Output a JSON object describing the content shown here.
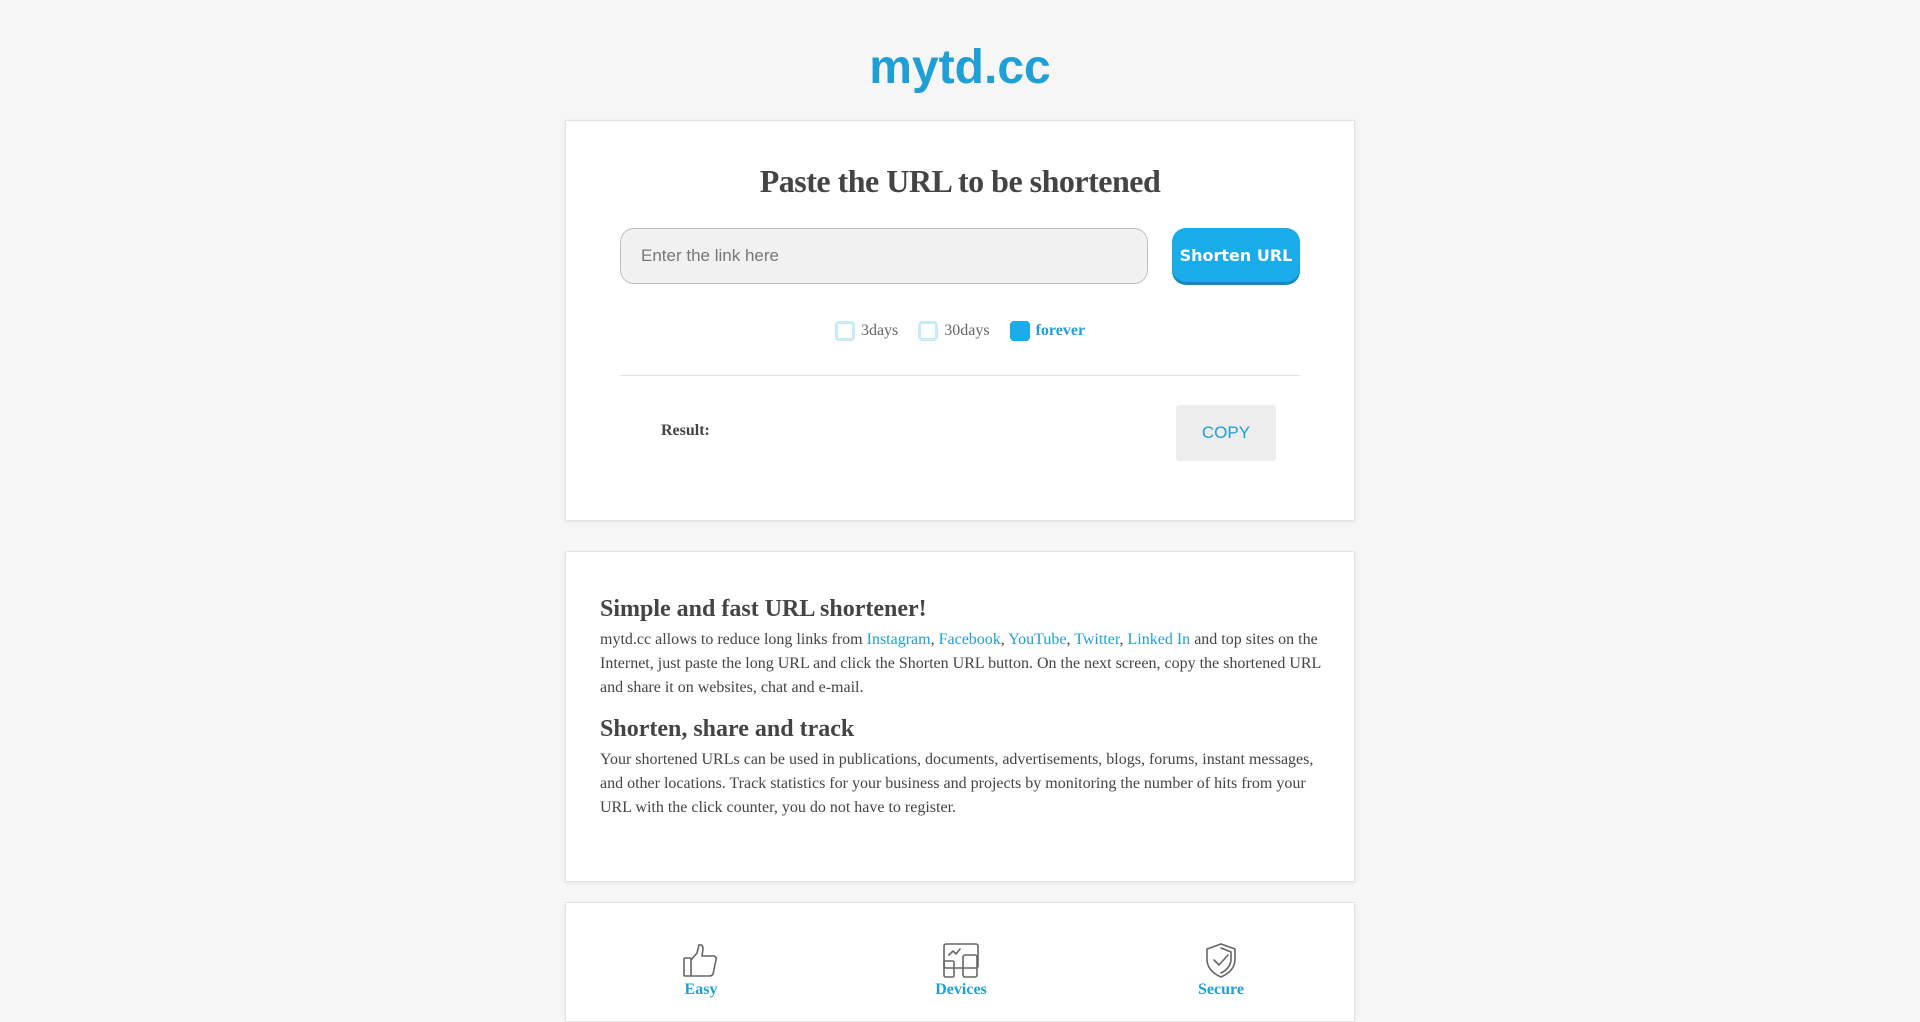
{
  "header": {
    "logo": "mytd.cc"
  },
  "shortener": {
    "title": "Paste the URL to be shortened",
    "input_placeholder": "Enter the link here",
    "input_value": "",
    "button_label": "Shorten URL",
    "options": [
      {
        "label": "3days",
        "selected": false
      },
      {
        "label": "30days",
        "selected": false
      },
      {
        "label": "forever",
        "selected": true
      }
    ],
    "result_label": "Result:",
    "result_value": "",
    "copy_label": "COPY"
  },
  "info": {
    "heading1": "Simple and fast URL shortener!",
    "p1_intro": "mytd.cc allows to reduce long links from ",
    "p1_links": [
      "Instagram",
      "Facebook",
      "YouTube",
      "Twitter",
      "Linked In"
    ],
    "p1_sep": ", ",
    "p1_rest": " and top sites on the Internet, just paste the long URL and click the Shorten URL button. On the next screen, copy the shortened URL and share it on websites, chat and e-mail.",
    "heading2": "Shorten, share and track",
    "p2": "Your shortened URLs can be used in publications, documents, advertisements, blogs, forums, instant messages, and other locations. Track statistics for your business and projects by monitoring the number of hits from your URL with the click counter, you do not have to register."
  },
  "features": [
    {
      "label": "Easy",
      "icon": "thumbs-up-icon"
    },
    {
      "label": "Devices",
      "icon": "devices-icon"
    },
    {
      "label": "Secure",
      "icon": "shield-check-icon"
    }
  ],
  "colors": {
    "accent": "#1e9fd6",
    "button": "#1aabe9",
    "background": "#f6f6f6"
  }
}
